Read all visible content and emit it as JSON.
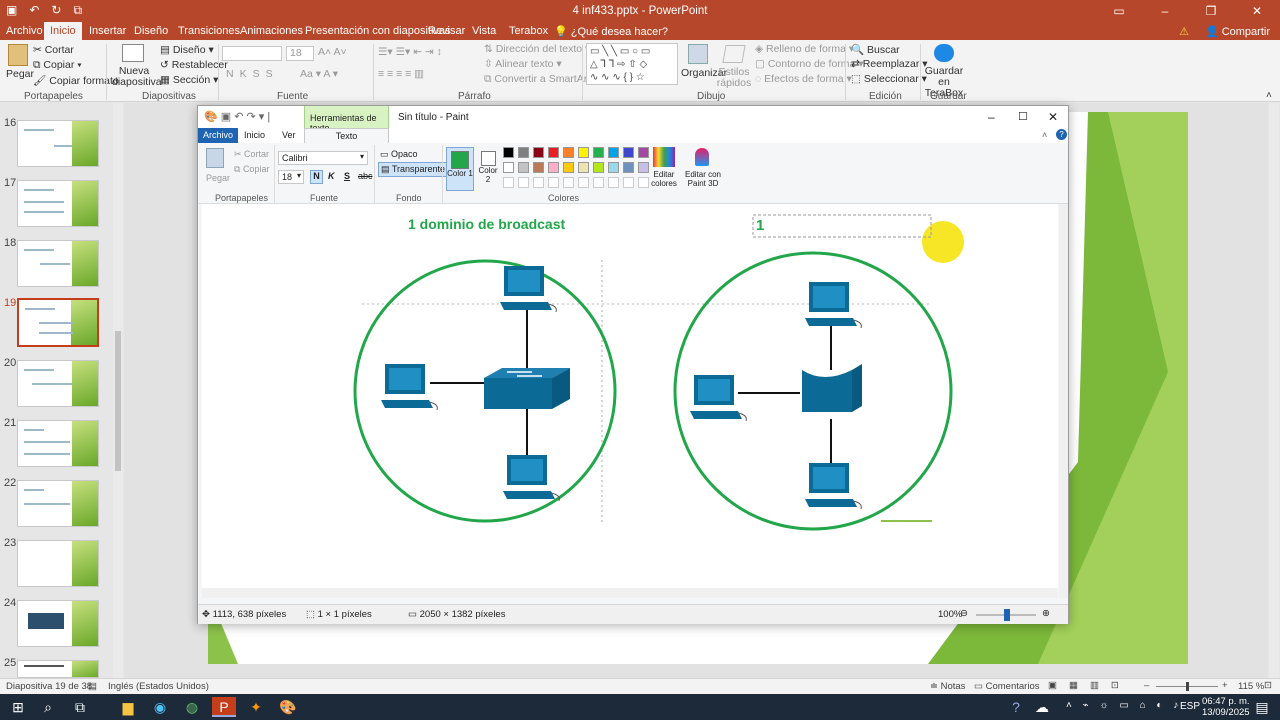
{
  "ppt": {
    "title": "4 inf433.pptx - PowerPoint",
    "tabs": [
      "Archivo",
      "Inicio",
      "Insertar",
      "Diseño",
      "Transiciones",
      "Animaciones",
      "Presentación con diapositivas",
      "Revisar",
      "Vista",
      "Terabox"
    ],
    "search": "¿Qué desea hacer?",
    "share": "Compartir",
    "ribbon": {
      "pegar": "Pegar",
      "cortar": "Cortar",
      "copiar": "Copiar",
      "copiar_formato": "Copiar formato",
      "nueva_diapositiva": "Nueva diapositiva",
      "diseno": "Diseño",
      "restablecer": "Restablecer",
      "seccion": "Sección",
      "font_size": "18",
      "direccion_texto": "Dirección del texto",
      "alinear_texto": "Alinear texto",
      "convertir_smartart": "Convertir a SmartArt",
      "organizar": "Organizar",
      "estilos_rapidos": "Estilos rápidos",
      "relleno": "Relleno de forma",
      "contorno": "Contorno de forma",
      "efectos": "Efectos de forma",
      "buscar": "Buscar",
      "reemplazar": "Reemplazar",
      "seleccionar": "Seleccionar",
      "guardar_terabox": "Guardar en TeraBox",
      "groups": [
        "Portapapeles",
        "Diapositivas",
        "Fuente",
        "Párrafo",
        "Dibujo",
        "Edición",
        "Guardar"
      ]
    }
  },
  "slides": {
    "numbers": [
      "16",
      "17",
      "18",
      "19",
      "20",
      "21",
      "22",
      "23",
      "24",
      "25"
    ],
    "selected": "19"
  },
  "paint": {
    "title": "Sin título - Paint",
    "context_tab": "Herramientas de texto",
    "tabs": [
      "Archivo",
      "Inicio",
      "Ver",
      "Texto"
    ],
    "pegar": "Pegar",
    "cortar": "Cortar",
    "copiar": "Copiar",
    "font_name": "Calibri",
    "font_size": "18",
    "opaco": "Opaco",
    "transparente": "Transparente",
    "color1": "Color 1",
    "color2": "Color 2",
    "editar_colores": "Editar colores",
    "editar_paint3d": "Editar con Paint 3D",
    "groups": [
      "Portapapeles",
      "Fuente",
      "Fondo",
      "Colores"
    ],
    "canvas_heading": "1 dominio de broadcast",
    "text_box_value": "1",
    "status": {
      "cursor": "1113, 638 píxeles",
      "selection": "1 × 1 píxeles",
      "size": "2050 × 1382 píxeles",
      "zoom": "100%"
    },
    "palette": [
      "#000000",
      "#7f7f7f",
      "#880015",
      "#ed1c24",
      "#ff7f27",
      "#fff200",
      "#22b14c",
      "#00a2e8",
      "#3f48cc",
      "#a349a4",
      "#ffffff",
      "#c3c3c3",
      "#b97a57",
      "#ffaec9",
      "#ffc90e",
      "#efe4b0",
      "#b5e61d",
      "#99d9ea",
      "#7092be",
      "#c8bfe7"
    ],
    "accent_green": "#22a64a",
    "device_blue": "#0b6a96"
  },
  "statusbar": {
    "slide": "Diapositiva 19 de 38",
    "language": "Inglés (Estados Unidos)",
    "notas": "Notas",
    "comentarios": "Comentarios",
    "zoom": "115 %"
  },
  "taskbar": {
    "lang": "ESP",
    "time": "06:47 p. m.",
    "date": "13/09/2025"
  }
}
